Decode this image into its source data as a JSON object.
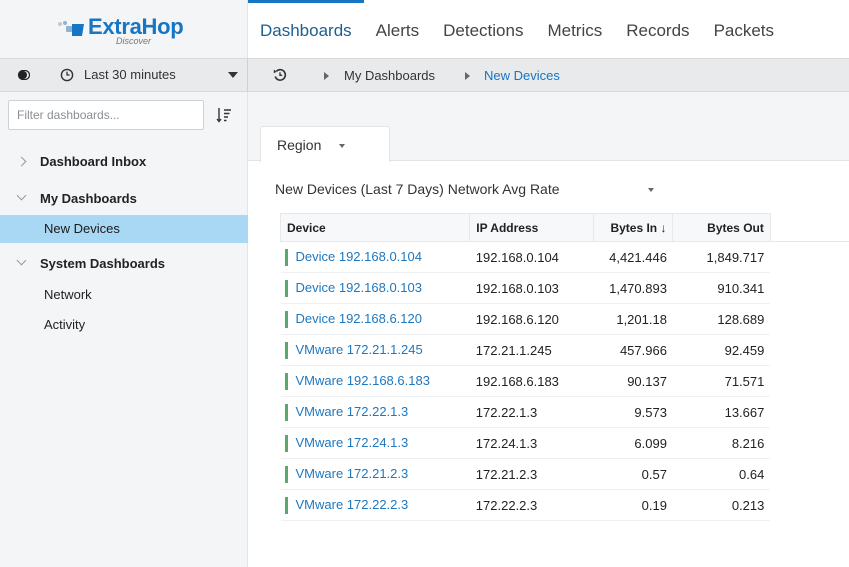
{
  "brand": {
    "name": "ExtraHop",
    "sub": "Discover",
    "accent": "#1776c4"
  },
  "nav": {
    "tabs": [
      {
        "label": "Dashboards"
      },
      {
        "label": "Alerts"
      },
      {
        "label": "Detections"
      },
      {
        "label": "Metrics"
      },
      {
        "label": "Records"
      },
      {
        "label": "Packets"
      }
    ],
    "active": "Dashboards"
  },
  "toolbar": {
    "time_range": "Last 30 minutes",
    "breadcrumb": [
      "My Dashboards",
      "New Devices"
    ]
  },
  "sidebar": {
    "filter_placeholder": "Filter dashboards...",
    "items": [
      {
        "label": "Dashboard Inbox",
        "type": "folder",
        "expanded": false
      },
      {
        "label": "My Dashboards",
        "type": "folder",
        "expanded": true
      },
      {
        "label": "New Devices",
        "type": "dashboard",
        "selected": true
      },
      {
        "label": "System Dashboards",
        "type": "folder",
        "expanded": true
      },
      {
        "label": "Network",
        "type": "dashboard"
      },
      {
        "label": "Activity",
        "type": "dashboard"
      }
    ],
    "selected_color": "#a8d8f4"
  },
  "main": {
    "region": {
      "label": "Region"
    },
    "widget": {
      "title": "New Devices (Last 7 Days) Network Avg Rate",
      "columns": [
        "Device",
        "IP Address",
        "Bytes In ↓",
        "Bytes Out"
      ],
      "rows": [
        {
          "device": "Device 192.168.0.104",
          "ip": "192.168.0.104",
          "bytes_in": "4,421.446",
          "bytes_out": "1,849.717"
        },
        {
          "device": "Device 192.168.0.103",
          "ip": "192.168.0.103",
          "bytes_in": "1,470.893",
          "bytes_out": "910.341"
        },
        {
          "device": "Device 192.168.6.120",
          "ip": "192.168.6.120",
          "bytes_in": "1,201.18",
          "bytes_out": "128.689"
        },
        {
          "device": "VMware 172.21.1.245",
          "ip": "172.21.1.245",
          "bytes_in": "457.966",
          "bytes_out": "92.459"
        },
        {
          "device": "VMware 192.168.6.183",
          "ip": "192.168.6.183",
          "bytes_in": "90.137",
          "bytes_out": "71.571"
        },
        {
          "device": "VMware 172.22.1.3",
          "ip": "172.22.1.3",
          "bytes_in": "9.573",
          "bytes_out": "13.667"
        },
        {
          "device": "VMware 172.24.1.3",
          "ip": "172.24.1.3",
          "bytes_in": "6.099",
          "bytes_out": "8.216"
        },
        {
          "device": "VMware 172.21.2.3",
          "ip": "172.21.2.3",
          "bytes_in": "0.57",
          "bytes_out": "0.64"
        },
        {
          "device": "VMware 172.22.2.3",
          "ip": "172.22.2.3",
          "bytes_in": "0.19",
          "bytes_out": "0.213"
        }
      ],
      "row_bar_color": "#5aa86a",
      "link_color": "#1d78c1"
    }
  }
}
